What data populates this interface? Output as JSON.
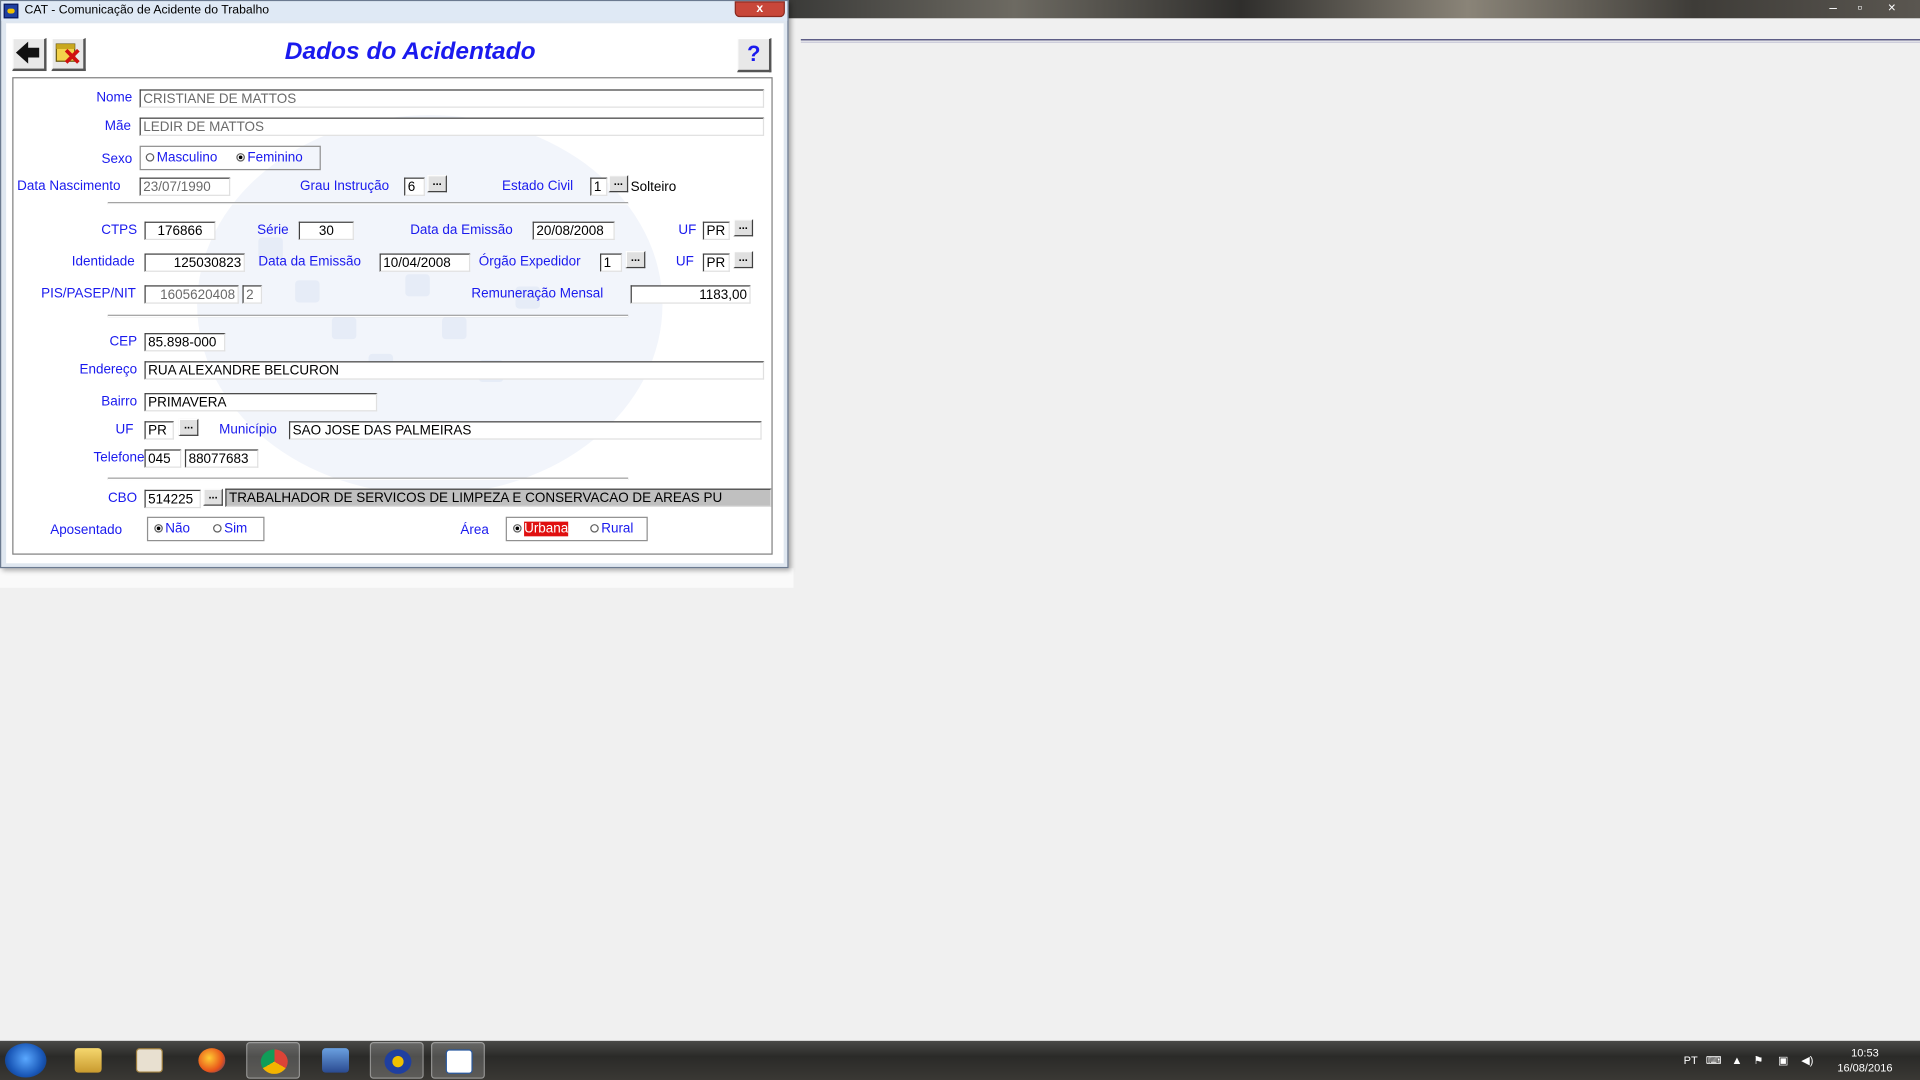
{
  "window": {
    "title": "CAT - Comunicação de Acidente do Trabalho",
    "close_label": "x"
  },
  "desktop_controls": {
    "minimize": "–",
    "restore": "▫",
    "close": "×"
  },
  "form": {
    "title": "Dados do Acidentado",
    "help_label": "?",
    "buttons": {
      "back": "back-arrow-icon",
      "exit": "exit-icon"
    },
    "fields": {
      "nome_label": "Nome",
      "nome": "CRISTIANE DE MATTOS",
      "mae_label": "Mãe",
      "mae": "LEDIR DE MATTOS",
      "sexo_label": "Sexo",
      "sexo_options": [
        "Masculino",
        "Feminino"
      ],
      "sexo_selected": "Feminino",
      "data_nascimento_label": "Data Nascimento",
      "data_nascimento": "23/07/1990",
      "grau_instrucao_label": "Grau Instrução",
      "grau_instrucao": "6",
      "estado_civil_label": "Estado Civil",
      "estado_civil": "1",
      "estado_civil_desc": "Solteiro",
      "ctps_label": "CTPS",
      "ctps": "176866",
      "serie_label": "Série",
      "serie": "30",
      "data_emissao_label": "Data da Emissão",
      "ctps_data_emissao": "20/08/2008",
      "uf_label": "UF",
      "ctps_uf": "PR",
      "identidade_label": "Identidade",
      "identidade": "125030823",
      "id_data_emissao": "10/04/2008",
      "orgao_expedidor_label": "Órgão Expedidor",
      "orgao_expedidor": "1",
      "id_uf": "PR",
      "pis_label": "PIS/PASEP/NIT",
      "pis": "1605620408",
      "pis_digito": "2",
      "remuneracao_label": "Remuneração Mensal",
      "remuneracao": "1183,00",
      "cep_label": "CEP",
      "cep": "85.898-000",
      "endereco_label": "Endereço",
      "endereco": "RUA ALEXANDRE BELCURON",
      "bairro_label": "Bairro",
      "bairro": "PRIMAVERA",
      "end_uf": "PR",
      "municipio_label": "Município",
      "municipio": "SAO JOSE DAS PALMEIRAS",
      "telefone_label": "Telefone",
      "telefone_ddd": "045",
      "telefone": "88077683",
      "cbo_label": "CBO",
      "cbo": "514225",
      "cbo_desc": "TRABALHADOR DE SERVICOS DE LIMPEZA E CONSERVACAO DE AREAS PU",
      "aposentado_label": "Aposentado",
      "aposentado_options": [
        "Não",
        "Sim"
      ],
      "aposentado_selected": "Não",
      "area_label": "Área",
      "area_options": [
        "Urbana",
        "Rural"
      ],
      "area_selected": "Urbana"
    }
  },
  "taskbar": {
    "apps": [
      "windows-explorer",
      "media-player",
      "firefox",
      "chrome",
      "network-app",
      "cat-app",
      "document-app"
    ],
    "language": "PT",
    "time": "10:53",
    "date": "16/08/2016"
  }
}
